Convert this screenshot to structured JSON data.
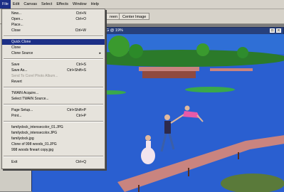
{
  "menubar": {
    "items": [
      "File",
      "Edit",
      "Canvas",
      "Select",
      "Effects",
      "Window",
      "Help"
    ]
  },
  "toolbar": {
    "screen_label": "reen",
    "center_image_label": "Center Image"
  },
  "document": {
    "title": "G @ 19%",
    "colors": {
      "sky": "#2f6fd6",
      "water": "#2a5fd0",
      "dock": "#c9847f",
      "trees": "#2b7a2a"
    }
  },
  "file_menu": {
    "items": [
      {
        "label": "New...",
        "shortcut": "Ctrl+N"
      },
      {
        "label": "Open...",
        "shortcut": "Ctrl+O"
      },
      {
        "label": "Place...",
        "shortcut": ""
      },
      {
        "label": "Close",
        "shortcut": "Ctrl+W"
      },
      {
        "label": "Quick Clone",
        "shortcut": "",
        "highlighted": true
      },
      {
        "label": "Clone",
        "shortcut": ""
      },
      {
        "label": "Clone Source",
        "shortcut": "",
        "submenu": true
      },
      {
        "label": "Save",
        "shortcut": "Ctrl+S"
      },
      {
        "label": "Save As...",
        "shortcut": "Ctrl+Shift+S"
      },
      {
        "label": "Send To Corel Photo Album...",
        "shortcut": "",
        "disabled": true
      },
      {
        "label": "Revert",
        "shortcut": ""
      },
      {
        "label": "TWAIN Acquire...",
        "shortcut": ""
      },
      {
        "label": "Select TWAIN Source...",
        "shortcut": ""
      },
      {
        "label": "Page Setup...",
        "shortcut": "Ctrl+Shift+P"
      },
      {
        "label": "Print...",
        "shortcut": "Ctrl+P"
      },
      {
        "label": "familydock_intensecolor_01.JPG",
        "shortcut": ""
      },
      {
        "label": "familydock_intensecolor.JPG",
        "shortcut": ""
      },
      {
        "label": "familydock.jpg",
        "shortcut": ""
      },
      {
        "label": "Clone of 998 woods_01.JPG",
        "shortcut": ""
      },
      {
        "label": "998 woods fineart copy.jpg",
        "shortcut": ""
      },
      {
        "label": "Exit",
        "shortcut": "Ctrl+Q"
      }
    ]
  }
}
